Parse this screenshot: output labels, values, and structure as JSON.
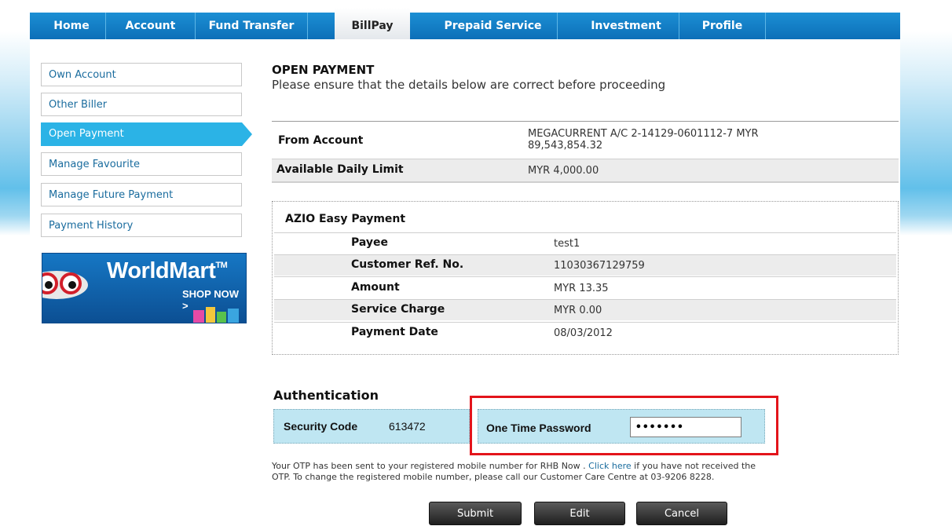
{
  "nav": {
    "tabs": [
      {
        "label": "Home"
      },
      {
        "label": "Account"
      },
      {
        "label": "Fund Transfer"
      },
      {
        "label": "BillPay",
        "active": true
      },
      {
        "label": "Prepaid Service"
      },
      {
        "label": "Investment"
      },
      {
        "label": "Profile"
      }
    ]
  },
  "sidebar": {
    "items": [
      {
        "label": "Own Account"
      },
      {
        "label": "Other Biller"
      },
      {
        "label": "Open Payment",
        "active": true
      },
      {
        "label": "Manage Favourite"
      },
      {
        "label": "Manage Future Payment"
      },
      {
        "label": "Payment History"
      }
    ],
    "banner": {
      "brand": "WorldMart",
      "tm": "TM",
      "cta": "SHOP NOW >"
    }
  },
  "main": {
    "title": "OPEN PAYMENT",
    "subtitle": "Please ensure that the details below are correct before proceeding",
    "from_account": {
      "label": "From Account",
      "value_line1": "MEGACURRENT A/C 2-14129-0601112-7 MYR",
      "value_line2": "89,543,854.32"
    },
    "daily_limit": {
      "label": "Available Daily Limit",
      "value": "MYR 4,000.00"
    },
    "biller": {
      "name": "AZIO Easy Payment",
      "rows": [
        {
          "label": "Payee",
          "value": "test1"
        },
        {
          "label": "Customer Ref. No.",
          "value": "11030367129759"
        },
        {
          "label": "Amount",
          "value": "MYR 13.35"
        },
        {
          "label": "Service Charge",
          "value": "MYR 0.00"
        },
        {
          "label": "Payment Date",
          "value": "08/03/2012"
        }
      ]
    }
  },
  "auth": {
    "title": "Authentication",
    "security_code_label": "Security Code",
    "security_code": "613472",
    "otp_label": "One Time Password",
    "otp_value": "•••••••",
    "note_part1": "Your OTP has been sent to your registered mobile number for RHB Now . ",
    "note_link": "Click here",
    "note_part2": " if you have not received the",
    "note_line2": "OTP. To change the registered mobile number, please call our Customer Care Centre at 03-9206 8228."
  },
  "buttons": {
    "submit": "Submit",
    "edit": "Edit",
    "cancel": "Cancel"
  },
  "colors": {
    "nav": "#0c6fb8",
    "active_sidebar": "#2bb3e6",
    "highlight": "#e3141b",
    "auth_cell": "#bfe6f2"
  }
}
